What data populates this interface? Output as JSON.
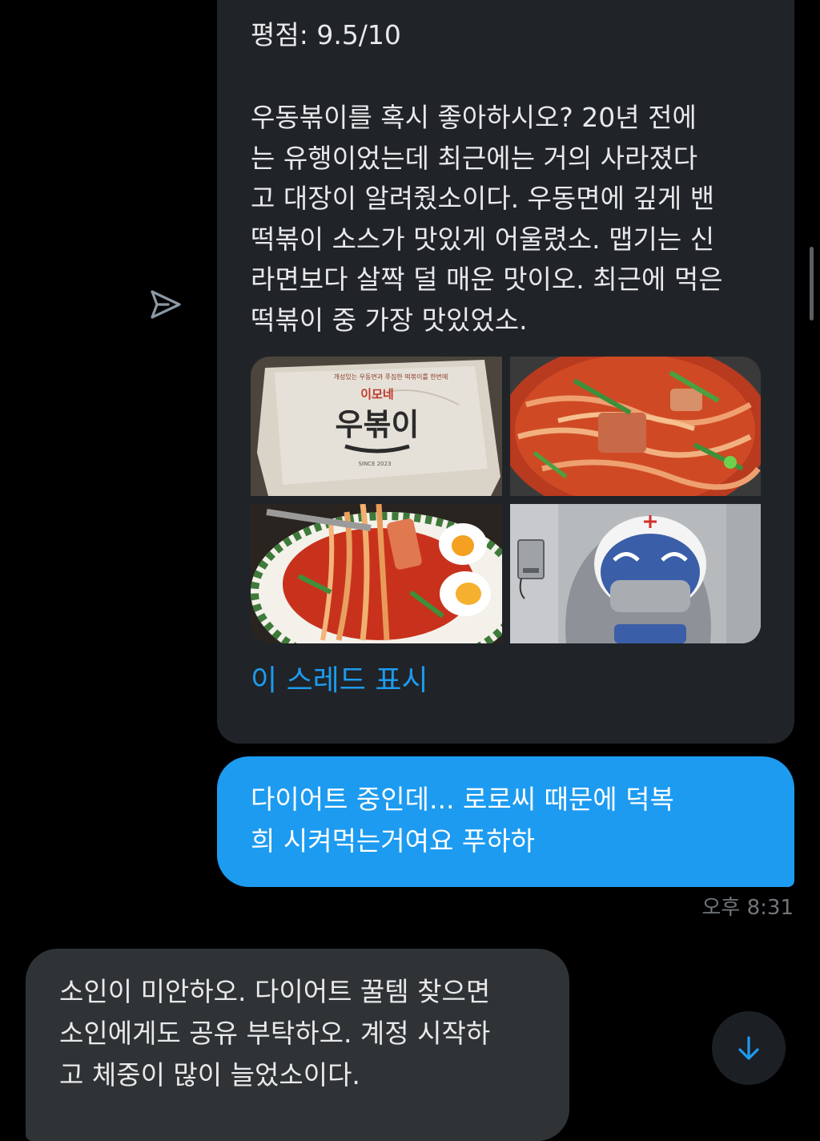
{
  "shared_post": {
    "rating": "평점: 9.5/10",
    "body_lines": [
      "우동볶이를 혹시 좋아하시오? 20년 전에",
      "는 유행이었는데 최근에는 거의 사라졌다",
      "고 대장이 알려줬소이다. 우동면에 깊게 밴",
      "떡볶이 소스가 맛있게 어울렸소. 맵기는 신",
      "라면보다 살짝 덜 매운 맛이오. 최근에 먹은",
      "떡볶이 중 가장 맛있었소."
    ],
    "media": {
      "package": {
        "brand": "이모네",
        "name": "우볶이",
        "tagline": "개성있는 우동면과 푸짐한 떡볶이를 한번에",
        "since": "SINCE 2023"
      }
    },
    "thread_link": "이 스레드 표시"
  },
  "sent_message": {
    "lines": [
      "다이어트 중인데... 로로씨 때문에 덕복",
      "희 시켜먹는거여요 푸하하"
    ],
    "time": "오후 8:31"
  },
  "received_message": {
    "lines": [
      "소인이 미안하오. 다이어트 꿀템 찾으면",
      "소인에게도 공유 부탁하오. 계정 시작하",
      "고 체중이 많이 늘었소이다."
    ]
  },
  "icons": {
    "share": "send-icon",
    "scroll_down": "arrow-down-icon"
  },
  "colors": {
    "background": "#000000",
    "card": "#202327",
    "sent_bubble": "#1d9bf0",
    "received_bubble": "#2f3336",
    "link": "#1d9bf0",
    "muted": "#71767b"
  }
}
